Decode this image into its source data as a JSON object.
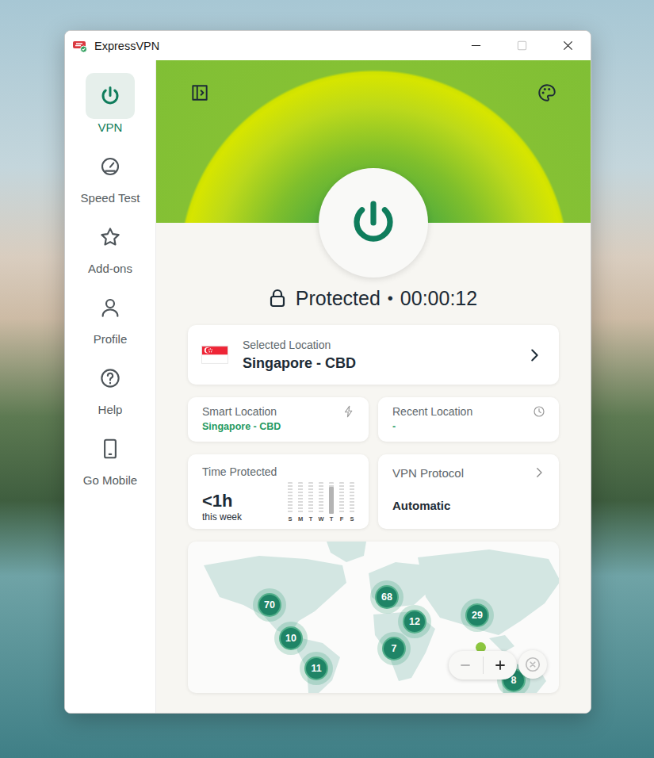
{
  "window": {
    "title": "ExpressVPN"
  },
  "sidebar": {
    "items": [
      {
        "label": "VPN",
        "selected": true
      },
      {
        "label": "Speed Test",
        "selected": false
      },
      {
        "label": "Add-ons",
        "selected": false
      },
      {
        "label": "Profile",
        "selected": false
      },
      {
        "label": "Help",
        "selected": false
      },
      {
        "label": "Go Mobile",
        "selected": false
      }
    ]
  },
  "connection": {
    "status": "Protected",
    "separator": "•",
    "timer": "00:00:12",
    "connected": true
  },
  "selected_location": {
    "caption": "Selected Location",
    "name": "Singapore - CBD"
  },
  "shortcuts": [
    {
      "kind": "smart",
      "caption": "Smart Location",
      "value": "Singapore - CBD"
    },
    {
      "kind": "recent",
      "caption": "Recent Location",
      "value": "-"
    }
  ],
  "time_protected": {
    "caption": "Time Protected",
    "value": "<1h",
    "sub": "this week",
    "days": [
      {
        "label": "S",
        "level": 0
      },
      {
        "label": "M",
        "level": 0
      },
      {
        "label": "T",
        "level": 0
      },
      {
        "label": "W",
        "level": 0
      },
      {
        "label": "T",
        "level": 0.85
      },
      {
        "label": "F",
        "level": 0
      },
      {
        "label": "S",
        "level": 0
      }
    ]
  },
  "protocol": {
    "caption": "VPN Protocol",
    "value": "Automatic"
  },
  "map": {
    "clusters": [
      {
        "count": "70"
      },
      {
        "count": "68"
      },
      {
        "count": "12"
      },
      {
        "count": "29"
      },
      {
        "count": "10"
      },
      {
        "count": "7"
      },
      {
        "count": "11"
      },
      {
        "count": "8"
      }
    ],
    "zoom_out": {
      "disabled": true
    },
    "zoom_in": {
      "disabled": false
    },
    "reset": {
      "disabled": true
    }
  }
}
